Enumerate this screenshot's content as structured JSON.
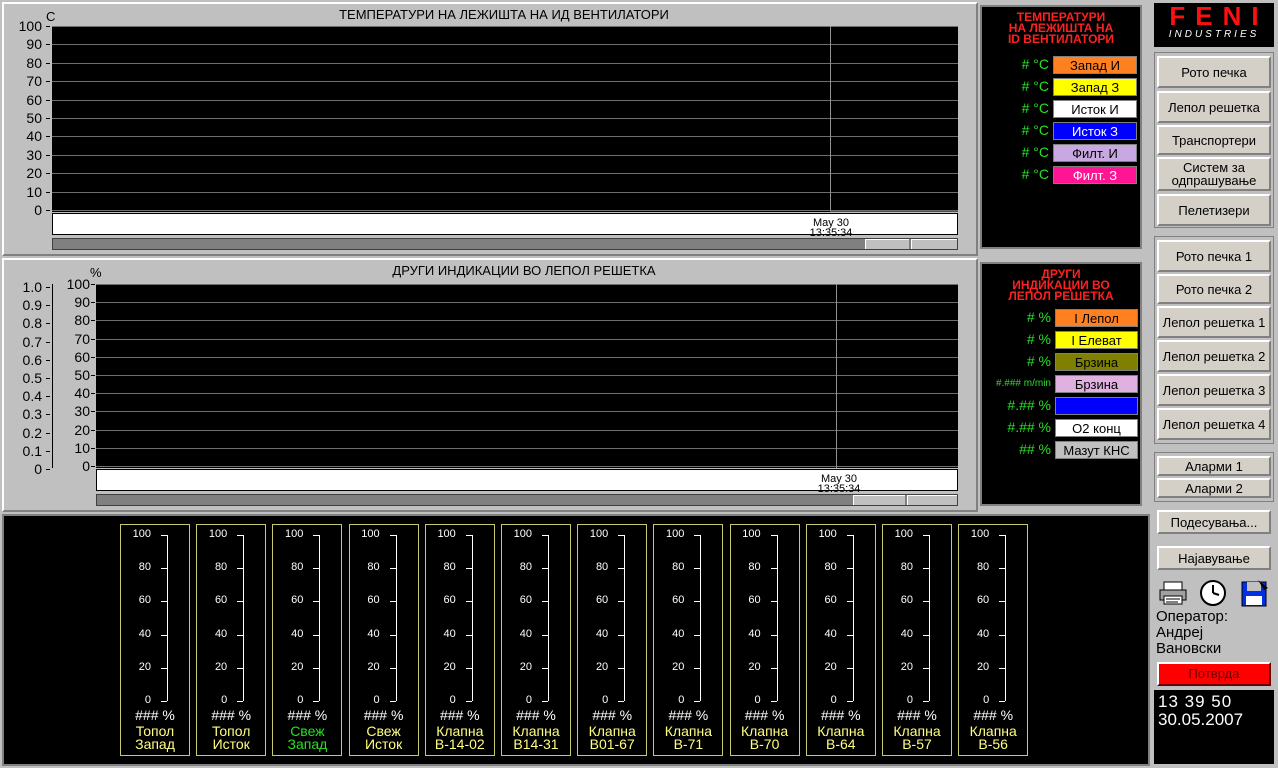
{
  "top_chart": {
    "title": "ТЕМПЕРАТУРИ НА ЛЕЖИШТА НА ИД ВЕНТИЛАТОРИ",
    "unit": "C",
    "y_ticks": [
      "100",
      "90",
      "80",
      "70",
      "60",
      "50",
      "40",
      "30",
      "20",
      "10",
      "0"
    ],
    "cursor_date": "May 30",
    "cursor_time": "13:35:34"
  },
  "top_legend": {
    "title_line1": "ТЕМПЕРАТУРИ",
    "title_line2": "НА ЛЕЖИШТА НА",
    "title_line3": "ID ВЕНТИЛАТОРИ",
    "items": [
      {
        "value": "# °C",
        "label": "Запад И",
        "bg": "#ff8020",
        "fg": "#000000"
      },
      {
        "value": "# °C",
        "label": "Запад З",
        "bg": "#ffff00",
        "fg": "#000000"
      },
      {
        "value": "# °C",
        "label": "Исток И",
        "bg": "#ffffff",
        "fg": "#000000"
      },
      {
        "value": "# °C",
        "label": "Исток З",
        "bg": "#0000ff",
        "fg": "#ffffff"
      },
      {
        "value": "# °C",
        "label": "Филт. И",
        "bg": "#c8a8e0",
        "fg": "#000000"
      },
      {
        "value": "# °C",
        "label": "Филт. З",
        "bg": "#ff1493",
        "fg": "#ffffff"
      }
    ]
  },
  "mid_chart": {
    "title": "ДРУГИ ИНДИКАЦИИ ВО ЛЕПОЛ РЕШЕТКА",
    "unit": "%",
    "y_ticks": [
      "100",
      "90",
      "80",
      "70",
      "60",
      "50",
      "40",
      "30",
      "20",
      "10",
      "0"
    ],
    "y2_ticks": [
      "1.0",
      "0.9",
      "0.8",
      "0.7",
      "0.6",
      "0.5",
      "0.4",
      "0.3",
      "0.2",
      "0.1",
      "0"
    ],
    "cursor_date": "May 30",
    "cursor_time": "13:35:34"
  },
  "mid_legend": {
    "title_line1": "ДРУГИ",
    "title_line2": "ИНДИКАЦИИ ВО",
    "title_line3": "ЛЕПОЛ РЕШЕТКА",
    "items": [
      {
        "value": "# %",
        "label": "I Лепол",
        "bg": "#ff8020",
        "fg": "#000000"
      },
      {
        "value": "# %",
        "label": "I Елеват",
        "bg": "#ffff00",
        "fg": "#000000"
      },
      {
        "value": "# %",
        "label": "Брзина",
        "bg": "#808000",
        "fg": "#000000"
      },
      {
        "value": "#.### m/min",
        "label": "Брзина",
        "bg": "#e0b0e0",
        "fg": "#000000"
      },
      {
        "value": "#.## %",
        "label": "",
        "bg": "#0000ff",
        "fg": "#ffffff"
      },
      {
        "value": "#.## %",
        "label": "O2 конц",
        "bg": "#ffffff",
        "fg": "#000000"
      },
      {
        "value": "## %",
        "label": "Мазут КНС",
        "bg": "#c0c0c0",
        "fg": "#000000"
      }
    ]
  },
  "gauges": {
    "ticks": [
      "100",
      "80",
      "60",
      "40",
      "20",
      "0"
    ],
    "items": [
      {
        "value": "### %",
        "name1": "Топол",
        "name2": "Запад",
        "color": "#ffff80"
      },
      {
        "value": "### %",
        "name1": "Топол",
        "name2": "Исток",
        "color": "#ffff80"
      },
      {
        "value": "### %",
        "name1": "Свеж",
        "name2": "Запад",
        "color": "#26e026"
      },
      {
        "value": "### %",
        "name1": "Свеж",
        "name2": "Исток",
        "color": "#ffff80"
      },
      {
        "value": "### %",
        "name1": "Клапна",
        "name2": "B-14-02",
        "color": "#ffff80"
      },
      {
        "value": "### %",
        "name1": "Клапна",
        "name2": "B14-31",
        "color": "#ffff80"
      },
      {
        "value": "### %",
        "name1": "Клапна",
        "name2": "B01-67",
        "color": "#ffff80"
      },
      {
        "value": "### %",
        "name1": "Клапна",
        "name2": "B-71",
        "color": "#ffff80"
      },
      {
        "value": "### %",
        "name1": "Клапна",
        "name2": "B-70",
        "color": "#ffff80"
      },
      {
        "value": "### %",
        "name1": "Клапна",
        "name2": "B-64",
        "color": "#ffff80"
      },
      {
        "value": "### %",
        "name1": "Клапна",
        "name2": "B-57",
        "color": "#ffff80"
      },
      {
        "value": "### %",
        "name1": "Клапна",
        "name2": "B-56",
        "color": "#ffff80"
      }
    ]
  },
  "logo": {
    "text": "FENI",
    "sub": "INDUSTRIES"
  },
  "nav": {
    "group1": [
      "Рото печка",
      "Лепол решетка",
      "Транспортери",
      "Систем за одпрашување",
      "Пелетизери"
    ],
    "group2": [
      "Рото печка 1",
      "Рото печка 2",
      "Лепол решетка 1",
      "Лепол решетка 2",
      "Лепол решетка 3",
      "Лепол решетка 4"
    ],
    "alarms": [
      "Аларми 1",
      "Аларми 2"
    ],
    "settings": "Подесувања...",
    "login": "Најавување",
    "confirm": "Потврда"
  },
  "operator": {
    "label": "Оператор:",
    "name1": "Андреј",
    "name2": "Вановски"
  },
  "clock": {
    "time": "13 39 50",
    "date": "30.05.2007"
  }
}
